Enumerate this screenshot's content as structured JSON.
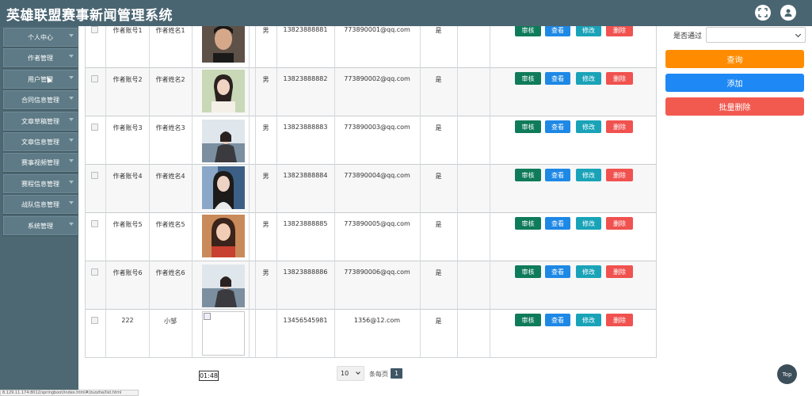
{
  "header": {
    "title": "英雄联盟赛事新闻管理系统"
  },
  "sidebar": {
    "items": [
      {
        "label": "个人中心"
      },
      {
        "label": "作者管理"
      },
      {
        "label": "用户管理"
      },
      {
        "label": "合同信息管理"
      },
      {
        "label": "文章草稿管理"
      },
      {
        "label": "文章信息管理"
      },
      {
        "label": "赛事视频管理"
      },
      {
        "label": "赛程信息管理"
      },
      {
        "label": "战队信息管理"
      },
      {
        "label": "系统管理"
      }
    ]
  },
  "table": {
    "rows": [
      {
        "account": "作者账号1",
        "name": "作者姓名1",
        "gender": "男",
        "phone": "13823888881",
        "email": "773890001@qq.com",
        "passed": "是"
      },
      {
        "account": "作者账号2",
        "name": "作者姓名2",
        "gender": "男",
        "phone": "13823888882",
        "email": "773890002@qq.com",
        "passed": "是"
      },
      {
        "account": "作者账号3",
        "name": "作者姓名3",
        "gender": "男",
        "phone": "13823888883",
        "email": "773890003@qq.com",
        "passed": "是"
      },
      {
        "account": "作者账号4",
        "name": "作者姓名4",
        "gender": "男",
        "phone": "13823888884",
        "email": "773890004@qq.com",
        "passed": "是"
      },
      {
        "account": "作者账号5",
        "name": "作者姓名5",
        "gender": "男",
        "phone": "13823888885",
        "email": "773890005@qq.com",
        "passed": "是"
      },
      {
        "account": "作者账号6",
        "name": "作者姓名6",
        "gender": "男",
        "phone": "13823888886",
        "email": "773890006@qq.com",
        "passed": "是"
      },
      {
        "account": "222",
        "name": "小邹",
        "gender": "",
        "phone": "13456545981",
        "email": "1356@12.com",
        "passed": "是"
      }
    ]
  },
  "actions": {
    "audit": "审核",
    "view": "查看",
    "edit": "修改",
    "delete": "删除"
  },
  "filter": {
    "label": "是否通过",
    "value": ""
  },
  "panel": {
    "query": "查询",
    "add": "添加",
    "batch_delete": "批量删除"
  },
  "pagination": {
    "page_size": "10",
    "per_page_label": "条每页",
    "current_page": "1"
  },
  "overlay": {
    "time": "01:48",
    "top_label": "Top"
  },
  "statusbar": {
    "url": "8.129.11.174:8012/springboot/index.html#/zuozhe/list.html"
  },
  "colors": {
    "header": "#4a6572",
    "sidebar": "#4d6873",
    "audit": "#0f7b5a",
    "view": "#1e88e5",
    "edit": "#1aa3b8",
    "delete": "#f0524f",
    "query": "#ff8c00",
    "add": "#1e88f5",
    "batch_delete": "#f25a50"
  }
}
